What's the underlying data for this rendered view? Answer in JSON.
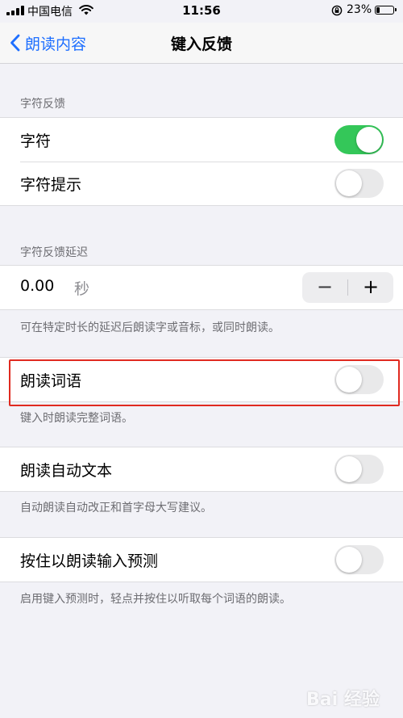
{
  "status_bar": {
    "carrier": "中国电信",
    "time": "11:56",
    "battery": "23%",
    "battery_level": 0.23
  },
  "nav": {
    "back_label": "朗读内容",
    "title": "键入反馈"
  },
  "section_character": {
    "header": "字符反馈",
    "rows": [
      {
        "label": "字符",
        "on": true
      },
      {
        "label": "字符提示",
        "on": false
      }
    ]
  },
  "section_delay": {
    "header": "字符反馈延迟",
    "value": "0.00",
    "unit": "秒",
    "minus": "−",
    "plus": "+",
    "footer": "可在特定时长的延迟后朗读字或音标，或同时朗读。"
  },
  "section_words": {
    "label": "朗读词语",
    "on": false,
    "footer": "键入时朗读完整词语。"
  },
  "section_autotext": {
    "label": "朗读自动文本",
    "on": false,
    "footer": "自动朗读自动改正和首字母大写建议。"
  },
  "section_predictions": {
    "label": "按住以朗读输入预测",
    "on": false,
    "footer": "启用键入预测时，轻点并按住以听取每个词语的朗读。"
  },
  "watermark": {
    "text": "Bai 经验"
  },
  "colors": {
    "accent": "#1e6fff",
    "toggle_on": "#34c759",
    "highlight": "#e02a20"
  }
}
